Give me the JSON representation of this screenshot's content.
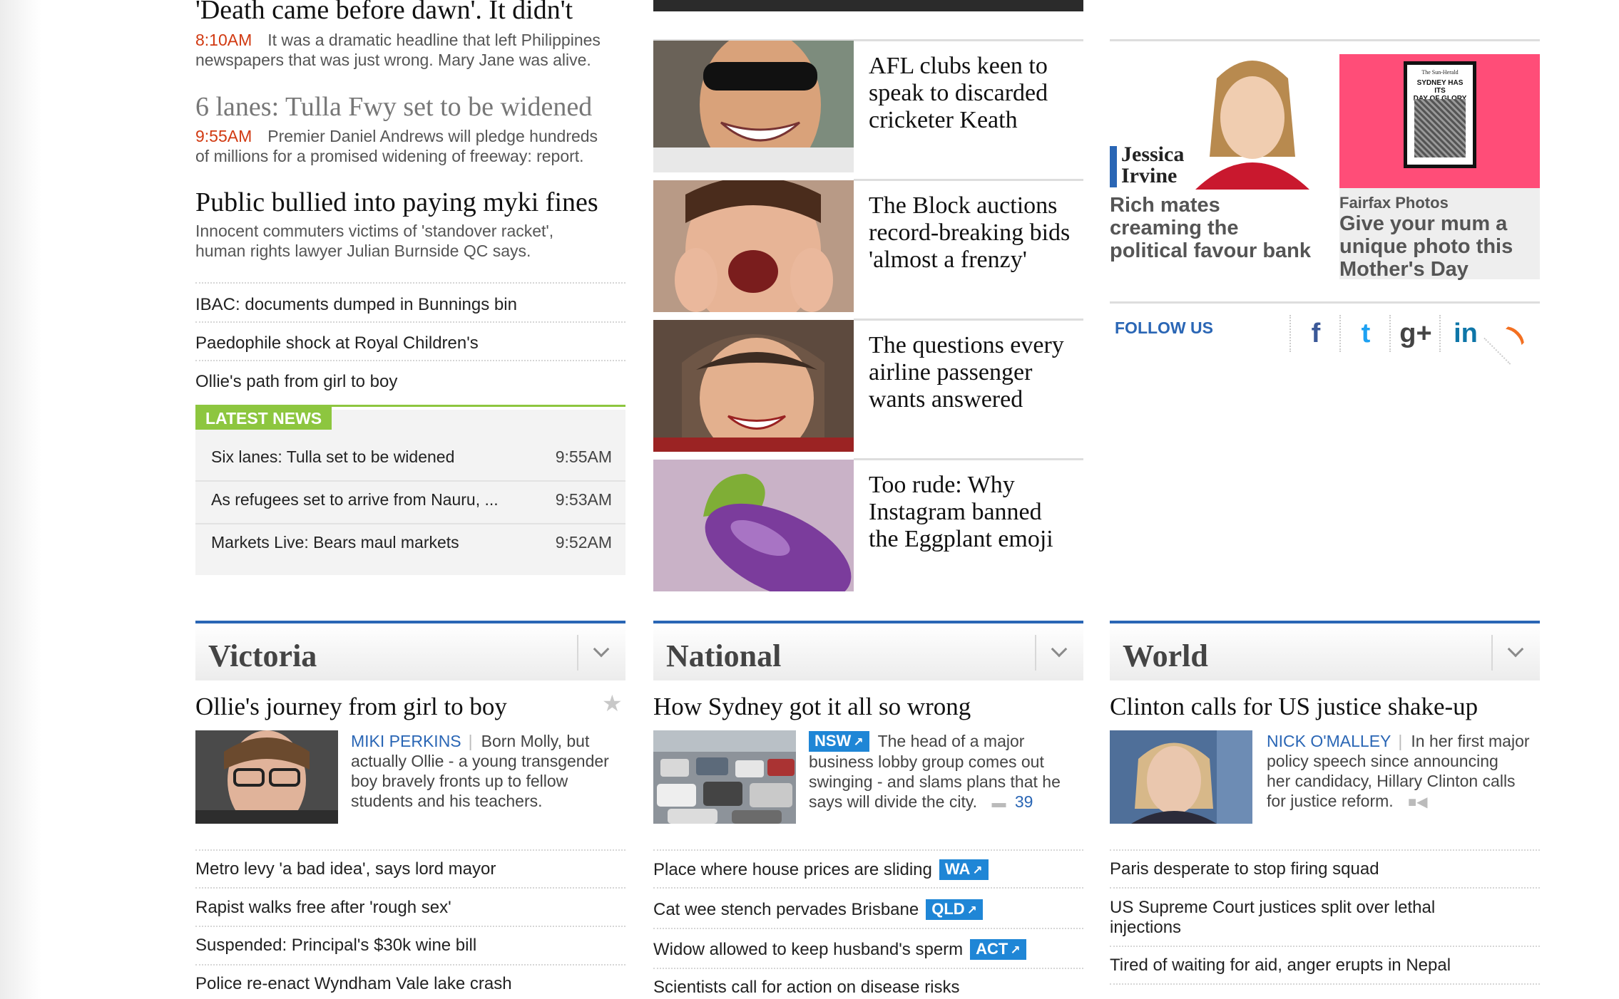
{
  "left_column": {
    "stories": [
      {
        "headline": "'Death came before dawn'. It didn't",
        "time": "8:10AM",
        "summary_line1": "It was a dramatic headline that left Philippines",
        "summary_line2": "newspapers that was just wrong. Mary Jane was alive."
      },
      {
        "headline": "6 lanes: Tulla Fwy set to be widened",
        "time": "9:55AM",
        "summary_line1": "Premier Daniel Andrews will pledge hundreds",
        "summary_line2": "of millions for a promised widening of freeway: report."
      },
      {
        "headline": "Public bullied into paying myki fines",
        "summary_line1": "Innocent commuters victims of 'standover racket',",
        "summary_line2": "human rights lawyer Julian Burnside QC says."
      }
    ],
    "links": [
      "IBAC: documents dumped in Bunnings bin",
      "Paedophile shock at Royal Children's",
      "Ollie's path from girl to boy"
    ],
    "latest_news": {
      "label": "LATEST NEWS",
      "items": [
        {
          "title": "Six lanes: Tulla set to be widened",
          "time": "9:55AM"
        },
        {
          "title": "As refugees set to arrive from Nauru, ...",
          "time": "9:53AM"
        },
        {
          "title": "Markets Live: Bears maul markets",
          "time": "9:52AM"
        }
      ]
    }
  },
  "middle_column": {
    "cards": [
      {
        "line1": "AFL clubs keen to",
        "line2": "speak to discarded",
        "line3": "cricketer Keath"
      },
      {
        "line1": "The Block auctions",
        "line2": "record-breaking bids",
        "line3": "'almost a frenzy'"
      },
      {
        "line1": "The questions every",
        "line2": "airline passenger",
        "line3": "wants answered"
      },
      {
        "line1": "Too rude: Why",
        "line2": "Instagram banned",
        "line3": "the  Eggplant emoji"
      }
    ]
  },
  "right_column": {
    "columnist": {
      "name_line1": "Jessica",
      "name_line2": "Irvine",
      "headline_line1": "Rich mates",
      "headline_line2": "creaming the",
      "headline_line3": "political favour bank"
    },
    "promo": {
      "poster_line1": "The Sun-Herald",
      "poster_line2": "SYDNEY HAS ITS",
      "poster_line3": "DAY OF GLORY",
      "kicker": "Fairfax Photos",
      "headline_line1": "Give your mum a",
      "headline_line2": "unique photo this",
      "headline_line3": "Mother's Day"
    },
    "follow_label": "FOLLOW US",
    "social_icons": [
      "facebook-icon",
      "twitter-icon",
      "google-plus-icon",
      "linkedin-icon",
      "rss-icon"
    ],
    "social_glyphs": [
      "f",
      "t",
      "g+",
      "in",
      ")"
    ],
    "social_colors": [
      "#3b5998",
      "#1da1f2",
      "#444444",
      "#0e76a8",
      "#f37021"
    ]
  },
  "sections": {
    "victoria": {
      "name": "Victoria",
      "lead_headline": "Ollie's journey from girl to boy",
      "author": "MIKI PERKINS",
      "blurb_line1": "Born Molly, but",
      "blurb_line2": "actually Ollie - a young transgender",
      "blurb_line3": "boy bravely fronts up to fellow",
      "blurb_line4": "students and his teachers.",
      "links": [
        "Metro levy 'a bad idea', says lord mayor",
        "Rapist walks free after 'rough sex'",
        "Suspended: Principal's $30k wine bill",
        "Police re-enact Wyndham Vale lake crash"
      ]
    },
    "national": {
      "name": "National",
      "lead_headline": "How Sydney got it all so wrong",
      "tag": "NSW",
      "blurb_line1": "The head of a major",
      "blurb_line2": "business lobby group comes out",
      "blurb_line3": "swinging - and slams plans that he",
      "blurb_line4": "says will divide the city.",
      "comment_count": "39",
      "links": [
        {
          "text": "Place where house prices are sliding",
          "tag": "WA"
        },
        {
          "text": "Cat wee stench pervades Brisbane",
          "tag": "QLD"
        },
        {
          "text": "Widow allowed to keep husband's sperm",
          "tag": "ACT"
        },
        {
          "text": "Scientists call for action on disease risks",
          "tag": ""
        }
      ]
    },
    "world": {
      "name": "World",
      "lead_headline": "Clinton calls for US justice shake-up",
      "author": "NICK O'MALLEY",
      "blurb_line1": "In her first major",
      "blurb_line2": "policy speech since announcing",
      "blurb_line3": "her candidacy, Hillary Clinton calls",
      "blurb_line4": "for justice reform.",
      "links": [
        "Paris desperate to stop firing squad",
        "US Supreme Court justices split over lethal",
        "injections",
        "Tired of waiting for aid, anger erupts in Nepal"
      ]
    }
  }
}
